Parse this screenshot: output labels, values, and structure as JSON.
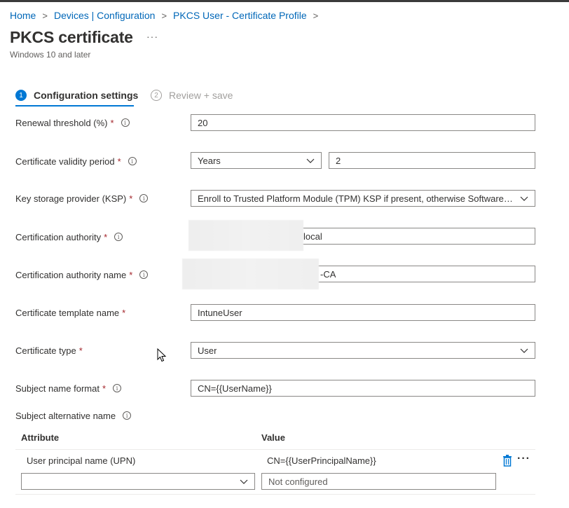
{
  "breadcrumb": {
    "items": [
      "Home",
      "Devices | Configuration",
      "PKCS User - Certificate Profile"
    ],
    "separator": ">"
  },
  "page": {
    "title": "PKCS certificate",
    "more_label": "···",
    "subtitle": "Windows 10 and later"
  },
  "steps": [
    {
      "number": "1",
      "label": "Configuration settings",
      "active": true
    },
    {
      "number": "2",
      "label": "Review + save",
      "active": false
    }
  ],
  "form": {
    "required_marker": "*",
    "info_glyph": "i",
    "renewal_threshold": {
      "label": "Renewal threshold (%)",
      "value": "20"
    },
    "validity_period": {
      "label": "Certificate validity period",
      "unit": "Years",
      "value": "2"
    },
    "ksp": {
      "label": "Key storage provider (KSP)",
      "value": "Enroll to Trusted Platform Module (TPM) KSP if present, otherwise Software K..."
    },
    "ca": {
      "label": "Certification authority",
      "value": "local"
    },
    "ca_name": {
      "label": "Certification authority name",
      "value": "-CA"
    },
    "template_name": {
      "label": "Certificate template name",
      "value": "IntuneUser"
    },
    "cert_type": {
      "label": "Certificate type",
      "value": "User"
    },
    "subject_format": {
      "label": "Subject name format",
      "value": "CN={{UserName}}"
    },
    "san": {
      "label": "Subject alternative name"
    }
  },
  "san_table": {
    "columns": [
      "Attribute",
      "Value"
    ],
    "rows": [
      {
        "attribute": "User principal name (UPN)",
        "value": "CN={{UserPrincipalName}}"
      }
    ],
    "new_row": {
      "attribute": "",
      "value_placeholder": "Not configured"
    }
  },
  "colors": {
    "accent": "#0078d4",
    "link": "#0067b8",
    "required": "#a4262c"
  },
  "icons": [
    "info-icon",
    "chevron-down-icon",
    "trash-icon",
    "more-icon",
    "mouse-cursor-icon"
  ]
}
